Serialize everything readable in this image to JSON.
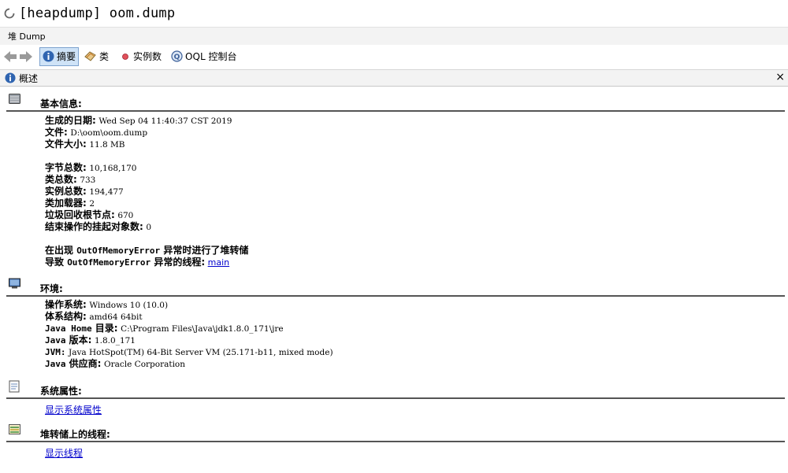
{
  "window": {
    "title": "[heapdump] oom.dump"
  },
  "breadcrumb": {
    "label": "堆 Dump"
  },
  "toolbar": {
    "tabs": [
      {
        "label": "摘要",
        "icon": "info-icon",
        "active": true
      },
      {
        "label": "类",
        "icon": "classes-icon",
        "active": false
      },
      {
        "label": "实例数",
        "icon": "instances-icon",
        "active": false
      },
      {
        "label": "OQL 控制台",
        "icon": "oql-icon",
        "active": false
      }
    ]
  },
  "panel": {
    "title": "概述",
    "close": "×"
  },
  "basic": {
    "title": "基本信息:",
    "date_label": "生成的日期:",
    "date_value": "Wed Sep 04 11:40:37 CST 2019",
    "file_label": "文件:",
    "file_value": "D:\\oom\\oom.dump",
    "size_label": "文件大小:",
    "size_value": "11.8 MB",
    "bytes_label": "字节总数:",
    "bytes_value": "10,168,170",
    "classes_label": "类总数:",
    "classes_value": "733",
    "instances_label": "实例总数:",
    "instances_value": "194,477",
    "loaders_label": "类加载器:",
    "loaders_value": "2",
    "gcroots_label": "垃圾回收根节点:",
    "gcroots_value": "670",
    "pending_label": "结束操作的挂起对象数:",
    "pending_value": "0",
    "oom1_pre": "在出现 ",
    "oom1_exc": "OutOfMemoryError",
    "oom1_post": " 异常时进行了堆转储",
    "oom2_pre": "导致 ",
    "oom2_exc": "OutOfMemoryError",
    "oom2_post": " 异常的线程:",
    "oom2_link": "main"
  },
  "env": {
    "title": "环境:",
    "os_label": "操作系统:",
    "os_value": "Windows 10 (10.0)",
    "arch_label": "体系结构:",
    "arch_value": "amd64 64bit",
    "home_label_a": "Java Home",
    "home_label_b": " 目录:",
    "home_value": "C:\\Program Files\\Java\\jdk1.8.0_171\\jre",
    "ver_label_a": "Java",
    "ver_label_b": " 版本:",
    "ver_value": "1.8.0_171",
    "jvm_label": "JVM:",
    "jvm_value": "Java HotSpot(TM) 64-Bit Server VM (25.171-b11, mixed mode)",
    "vendor_label_a": "Java",
    "vendor_label_b": " 供应商:",
    "vendor_value": "Oracle Corporation"
  },
  "sysprops": {
    "title": "系统属性:",
    "link": "显示系统属性"
  },
  "threads": {
    "title": "堆转储上的线程:",
    "link": "显示线程"
  }
}
